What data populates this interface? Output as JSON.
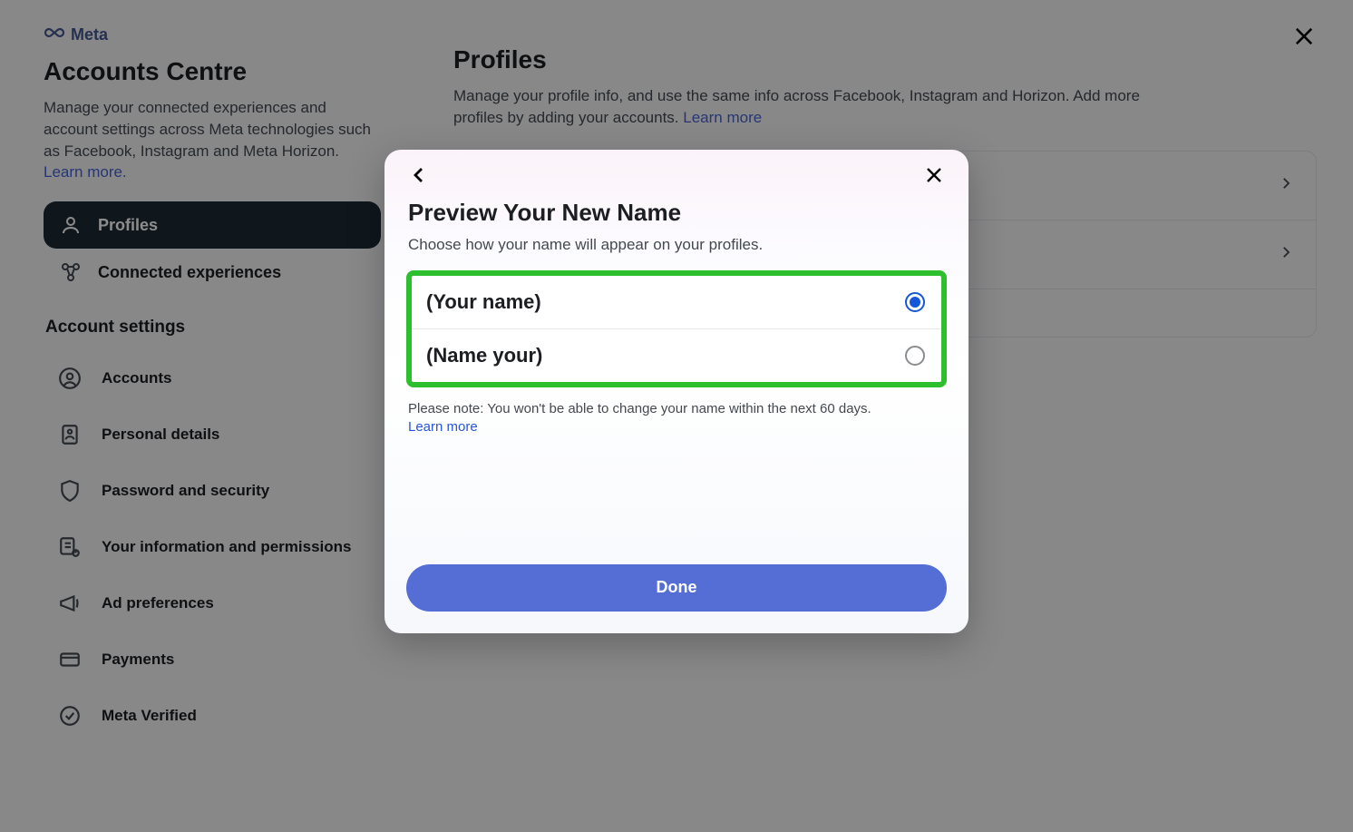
{
  "brand": "Meta",
  "sidebar": {
    "title": "Accounts Centre",
    "description_prefix": "Manage your connected experiences and account settings across Meta technologies such as Facebook, Instagram and Meta Horizon. ",
    "learn_more": "Learn more.",
    "nav": [
      {
        "label": "Profiles",
        "icon": "person-icon",
        "active": true
      },
      {
        "label": "Connected experiences",
        "icon": "connections-icon",
        "active": false
      }
    ],
    "settings_heading": "Account settings",
    "settings": [
      {
        "label": "Accounts",
        "icon": "account-circle-icon"
      },
      {
        "label": "Personal details",
        "icon": "id-card-icon"
      },
      {
        "label": "Password and security",
        "icon": "shield-icon"
      },
      {
        "label": "Your information and permissions",
        "icon": "info-permissions-icon"
      },
      {
        "label": "Ad preferences",
        "icon": "megaphone-icon"
      },
      {
        "label": "Payments",
        "icon": "card-icon"
      },
      {
        "label": "Meta Verified",
        "icon": "verified-icon"
      }
    ]
  },
  "main": {
    "title": "Profiles",
    "description_prefix": "Manage your profile info, and use the same info across Facebook, Instagram and Horizon. Add more profiles by adding your accounts. ",
    "learn_more": "Learn more"
  },
  "dialog": {
    "title": "Preview Your New Name",
    "subtitle": "Choose how your name will appear on your profiles.",
    "options": [
      {
        "label": "(Your name)",
        "selected": true
      },
      {
        "label": "(Name your)",
        "selected": false
      }
    ],
    "note_text": "Please note: You won't be able to change your name within the next 60 days. ",
    "note_link": "Learn more",
    "done_label": "Done"
  }
}
